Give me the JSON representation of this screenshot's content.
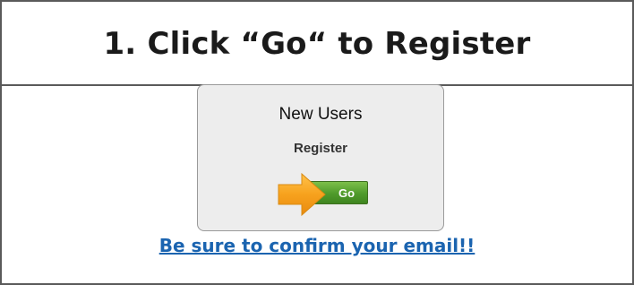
{
  "header": {
    "title": "1. Click “Go“ to Register"
  },
  "card": {
    "heading": "New Users",
    "subheading": "Register",
    "go_label": "Go"
  },
  "footer": {
    "confirm_text": "Be sure to confirm your email!!"
  },
  "colors": {
    "arrow": "#f5a01a",
    "go_button": "#4f9a2b",
    "link": "#1b64b0",
    "border": "#5a5a5a"
  },
  "icons": {
    "arrow": "arrow-right-icon"
  }
}
